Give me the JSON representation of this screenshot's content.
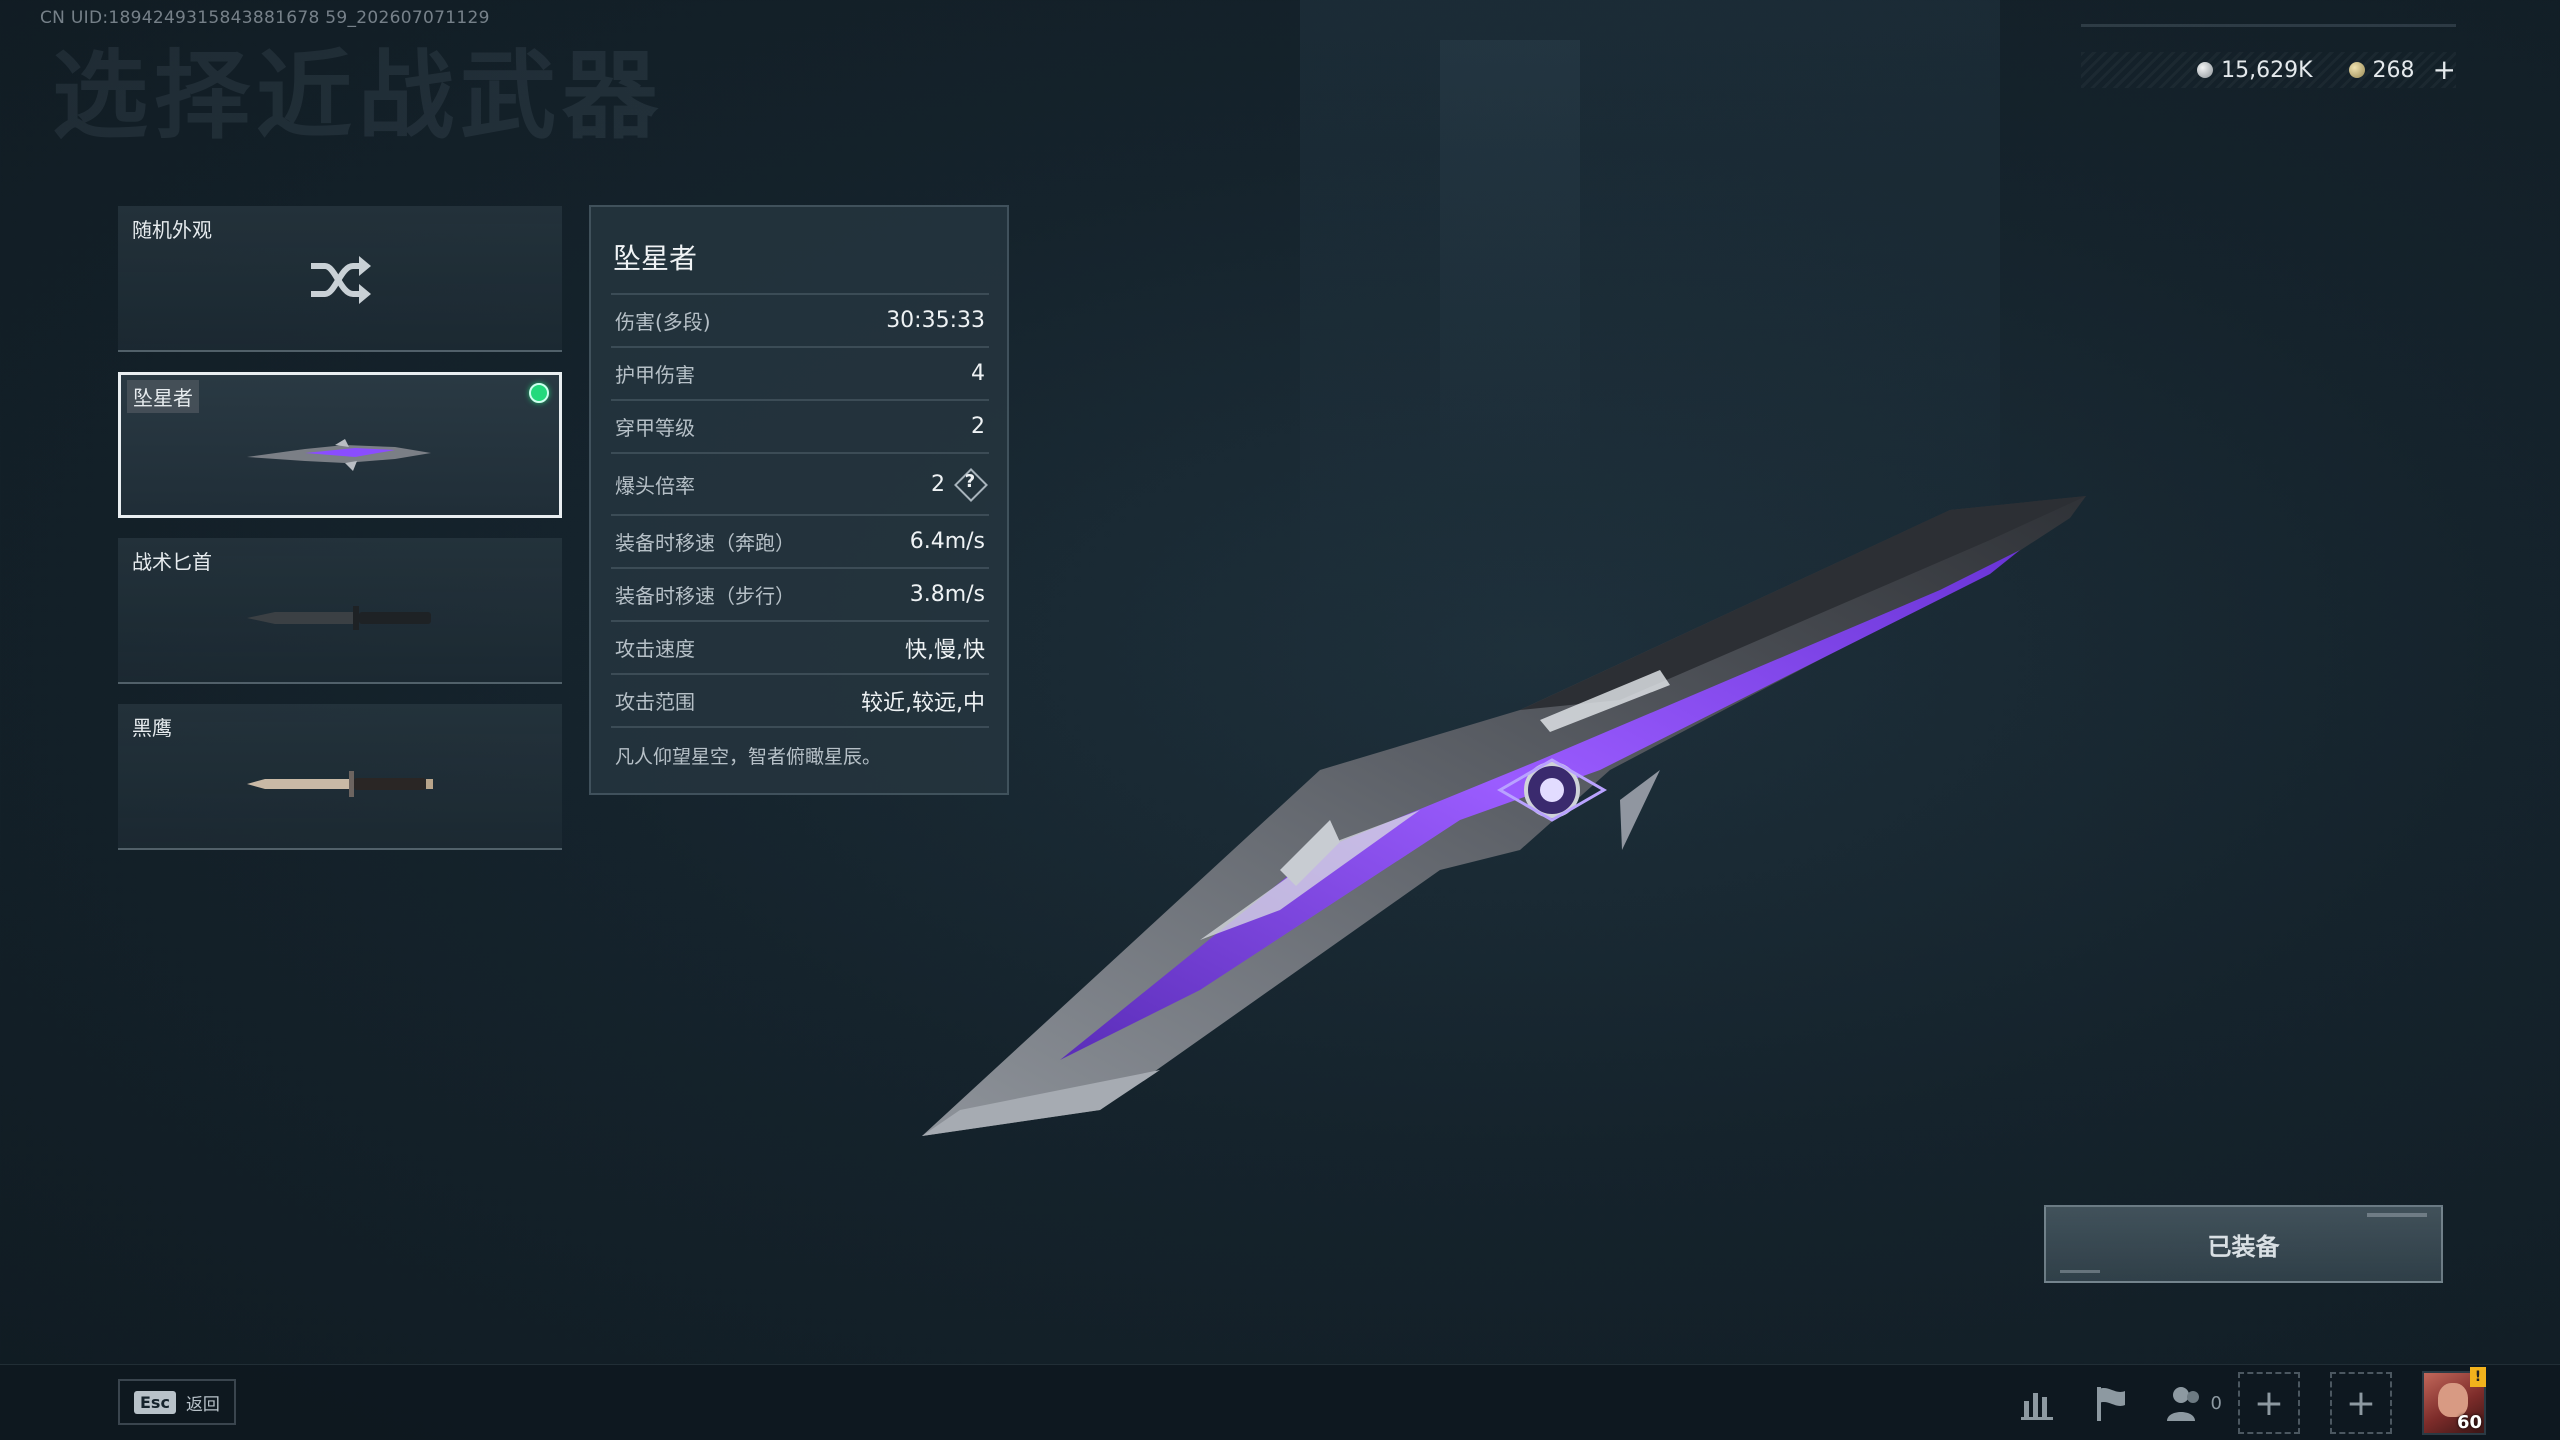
{
  "uid": "CN UID:1894249315843881678 59_202607071129",
  "page_title": "选择近战武器",
  "currency": {
    "silver": "15,629K",
    "gold": "268",
    "add_label": "+"
  },
  "weapons": [
    {
      "label": "随机外观"
    },
    {
      "label": "坠星者"
    },
    {
      "label": "战术匕首"
    },
    {
      "label": "黑鹰"
    }
  ],
  "stats": {
    "title": "坠星者",
    "rows": [
      {
        "name": "伤害(多段)",
        "value": "30:35:33"
      },
      {
        "name": "护甲伤害",
        "value": "4"
      },
      {
        "name": "穿甲等级",
        "value": "2"
      },
      {
        "name": "爆头倍率",
        "value": "2"
      },
      {
        "name": "装备时移速（奔跑）",
        "value": "6.4m/s"
      },
      {
        "name": "装备时移速（步行）",
        "value": "3.8m/s"
      },
      {
        "name": "攻击速度",
        "value": "快,慢,快"
      },
      {
        "name": "攻击范围",
        "value": "较近,较远,中"
      }
    ],
    "help_label": "?",
    "description": "凡人仰望星空，智者俯瞰星辰。"
  },
  "equipped_button": "已装备",
  "bottom": {
    "esc_key": "Esc",
    "back_label": "返回",
    "friends_count": "0",
    "plus_label": "+",
    "avatar_level": "60",
    "alert_mark": "!"
  },
  "colors": {
    "equipped_dot": "#23d97c",
    "accent_purple": "#8a4dff",
    "background": "#15232c"
  },
  "icons": [
    "shuffle-icon",
    "stats-chart-icon",
    "flag-icon",
    "friends-icon",
    "plus-icon"
  ]
}
